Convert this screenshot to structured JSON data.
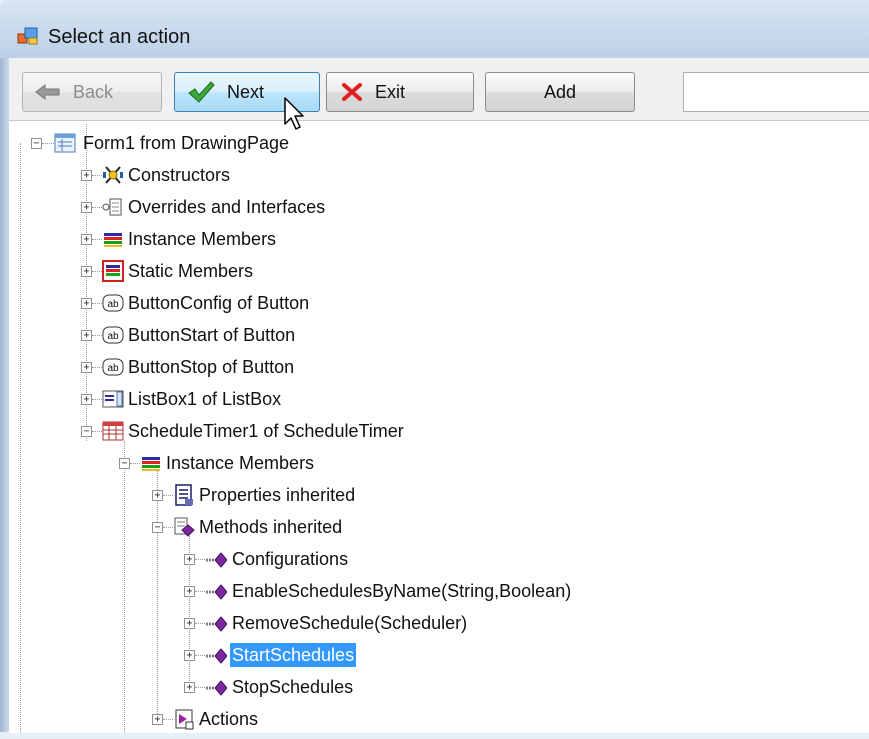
{
  "window": {
    "title": "Select an action"
  },
  "toolbar": {
    "back_label": "Back",
    "next_label": "Next",
    "exit_label": "Exit",
    "add_label": "Add",
    "search_value": ""
  },
  "tree": {
    "nodes": [
      {
        "label": "Form1 from DrawingPage",
        "icon": "form-icon",
        "expanded": true
      },
      {
        "label": "Constructors",
        "icon": "constructor-icon",
        "expanded": false
      },
      {
        "label": "Overrides and Interfaces",
        "icon": "interface-icon",
        "expanded": false
      },
      {
        "label": "Instance Members",
        "icon": "members-icon",
        "expanded": false
      },
      {
        "label": "Static Members",
        "icon": "static-members-icon",
        "expanded": false
      },
      {
        "label": "ButtonConfig of Button",
        "icon": "button-control-icon",
        "expanded": false
      },
      {
        "label": "ButtonStart of Button",
        "icon": "button-control-icon",
        "expanded": false
      },
      {
        "label": "ButtonStop of Button",
        "icon": "button-control-icon",
        "expanded": false
      },
      {
        "label": "ListBox1 of ListBox",
        "icon": "listbox-icon",
        "expanded": false
      },
      {
        "label": "ScheduleTimer1 of ScheduleTimer",
        "icon": "calendar-icon",
        "expanded": true
      },
      {
        "label": "Instance Members",
        "icon": "members-icon",
        "expanded": true
      },
      {
        "label": "Properties inherited",
        "icon": "properties-icon",
        "expanded": false
      },
      {
        "label": "Methods inherited",
        "icon": "methods-icon",
        "expanded": true
      },
      {
        "label": "Configurations",
        "icon": "method-icon",
        "expanded": false
      },
      {
        "label": "EnableSchedulesByName(String,Boolean)",
        "icon": "method-icon",
        "expanded": false
      },
      {
        "label": "RemoveSchedule(Scheduler)",
        "icon": "method-icon",
        "expanded": false
      },
      {
        "label": "StartSchedules",
        "icon": "method-icon",
        "expanded": false,
        "selected": true
      },
      {
        "label": "StopSchedules",
        "icon": "method-icon",
        "expanded": false
      },
      {
        "label": "Actions",
        "icon": "actions-icon",
        "expanded": false
      }
    ]
  },
  "colors": {
    "selection": "#3399ff",
    "accent": "#3c7fb1"
  }
}
